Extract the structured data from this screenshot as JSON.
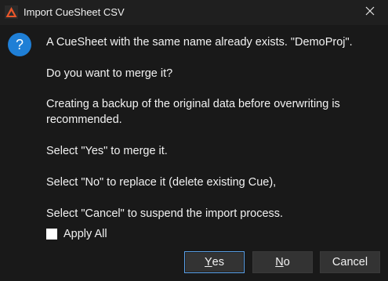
{
  "window": {
    "title": "Import CueSheet CSV",
    "app_icon": "criware-triangle-icon",
    "close_icon": "close-icon"
  },
  "dialog": {
    "icon": "question-icon",
    "messages": [
      "A CueSheet with the same name already exists. \"DemoProj\".",
      "Do you want to merge it?",
      "Creating a backup of the original data before overwriting is recommended.",
      "Select \"Yes\" to merge it.",
      "Select \"No\" to replace it (delete existing Cue),",
      "Select \"Cancel\" to suspend the import process."
    ],
    "apply_all": {
      "label": "Apply All",
      "checked": false
    }
  },
  "buttons": {
    "yes": {
      "mnemonic": "Y",
      "rest": "es"
    },
    "no": {
      "mnemonic": "N",
      "rest": "o"
    },
    "cancel": {
      "label": "Cancel"
    }
  },
  "colors": {
    "background": "#191919",
    "text": "#f2f2f2",
    "accent": "#1f7fd6",
    "default_button_border": "#5aa0e8",
    "app_icon": "#e8562a"
  }
}
